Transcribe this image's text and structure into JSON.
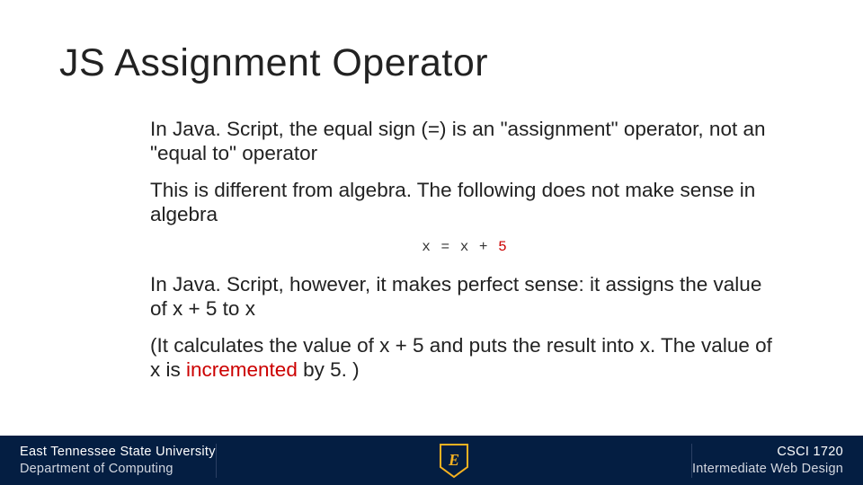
{
  "title": "JS Assignment Operator",
  "body": {
    "p1": "In Java. Script, the equal sign (=) is an \"assignment\" operator, not an \"equal to\" operator",
    "p2": "This is different from algebra. The following does not make sense in algebra",
    "code_lhs": "x = x + ",
    "code_num": "5",
    "p3": "In Java. Script, however, it makes perfect sense: it assigns the value of x + 5 to x",
    "p4_a": "(It calculates the value of x + 5 and puts the result into x. The value of x is ",
    "p4_inc": "incremented",
    "p4_b": " by 5. )"
  },
  "footer": {
    "university": "East Tennessee State University",
    "department": "Department of Computing",
    "logo_letter": "E",
    "course_code": "CSCI 1720",
    "course_name": "Intermediate Web Design"
  },
  "colors": {
    "footer_bg": "#041e42",
    "accent_gold": "#f6b221",
    "code_red": "#c00"
  }
}
